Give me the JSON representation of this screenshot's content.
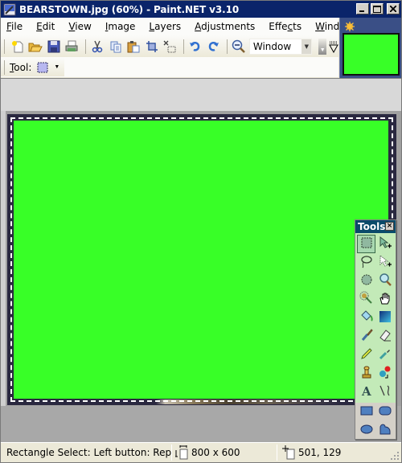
{
  "window": {
    "title": "BEARSTOWN.jpg (60%) - Paint.NET v3.10",
    "minimize_label": "_",
    "maximize_label": "□",
    "close_label": "✕"
  },
  "menu": {
    "items": [
      {
        "label": "File",
        "mnemonic": "F"
      },
      {
        "label": "Edit",
        "mnemonic": "E"
      },
      {
        "label": "View",
        "mnemonic": "V"
      },
      {
        "label": "Image",
        "mnemonic": "I"
      },
      {
        "label": "Layers",
        "mnemonic": "L"
      },
      {
        "label": "Adjustments",
        "mnemonic": "A"
      },
      {
        "label": "Effects",
        "mnemonic": "c"
      },
      {
        "label": "Window",
        "mnemonic": "W"
      }
    ]
  },
  "toolbar": {
    "buttons": [
      {
        "name": "new-image",
        "icon": "new-document-icon"
      },
      {
        "name": "open",
        "icon": "open-folder-icon"
      },
      {
        "name": "save",
        "icon": "save-disk-icon"
      },
      {
        "name": "print",
        "icon": "printer-icon"
      },
      {
        "name": "cut",
        "icon": "scissors-icon"
      },
      {
        "name": "copy",
        "icon": "copy-icon"
      },
      {
        "name": "paste",
        "icon": "paste-icon"
      },
      {
        "name": "crop-to-selection",
        "icon": "crop-icon"
      },
      {
        "name": "deselect",
        "icon": "deselect-icon"
      },
      {
        "name": "undo",
        "icon": "undo-icon"
      },
      {
        "name": "redo",
        "icon": "redo-icon"
      }
    ],
    "zoom_value": "Window"
  },
  "tool_options": {
    "tool_label": "Tool:",
    "tool_mnemonic": "T",
    "current_tool_icon": "rectangle-select-icon"
  },
  "thumbnail": {
    "color": "#38ff27"
  },
  "canvas": {
    "fill_color": "#38ff27"
  },
  "tools_panel": {
    "title": "Tools",
    "close_label": "×",
    "tools": [
      {
        "name": "rectangle-select",
        "icon": "rectangle-select-icon",
        "active": true
      },
      {
        "name": "move-selected-pixels",
        "icon": "move-pixels-icon",
        "active": false
      },
      {
        "name": "lasso-select",
        "icon": "lasso-icon",
        "active": false
      },
      {
        "name": "move-selection",
        "icon": "move-selection-icon",
        "active": false
      },
      {
        "name": "ellipse-select",
        "icon": "ellipse-select-icon",
        "active": false
      },
      {
        "name": "zoom",
        "icon": "magnifier-icon",
        "active": false
      },
      {
        "name": "magic-wand",
        "icon": "magic-wand-icon",
        "active": false
      },
      {
        "name": "pan",
        "icon": "hand-icon",
        "active": false
      },
      {
        "name": "paint-bucket",
        "icon": "paint-bucket-icon",
        "active": false
      },
      {
        "name": "gradient",
        "icon": "gradient-icon",
        "active": false
      },
      {
        "name": "paintbrush",
        "icon": "paintbrush-icon",
        "active": false
      },
      {
        "name": "eraser",
        "icon": "eraser-icon",
        "active": false
      },
      {
        "name": "pencil",
        "icon": "pencil-icon",
        "active": false
      },
      {
        "name": "color-picker",
        "icon": "eyedropper-icon",
        "active": false
      },
      {
        "name": "clone-stamp",
        "icon": "clone-stamp-icon",
        "active": false
      },
      {
        "name": "recolor",
        "icon": "recolor-icon",
        "active": false
      },
      {
        "name": "text",
        "icon": "text-icon",
        "active": false
      },
      {
        "name": "line-curve",
        "icon": "line-curve-icon",
        "active": false
      },
      {
        "name": "rectangle",
        "icon": "rectangle-shape-icon",
        "active": false
      },
      {
        "name": "rounded-rectangle",
        "icon": "rounded-rectangle-icon",
        "active": false
      },
      {
        "name": "ellipse",
        "icon": "ellipse-shape-icon",
        "active": false
      },
      {
        "name": "freeform-shape",
        "icon": "freeform-shape-icon",
        "active": false
      }
    ]
  },
  "status": {
    "hint": "Rectangle Select: Left button: Replace. Cl",
    "image_size": "800 x 600",
    "cursor_position": "501, 129"
  }
}
